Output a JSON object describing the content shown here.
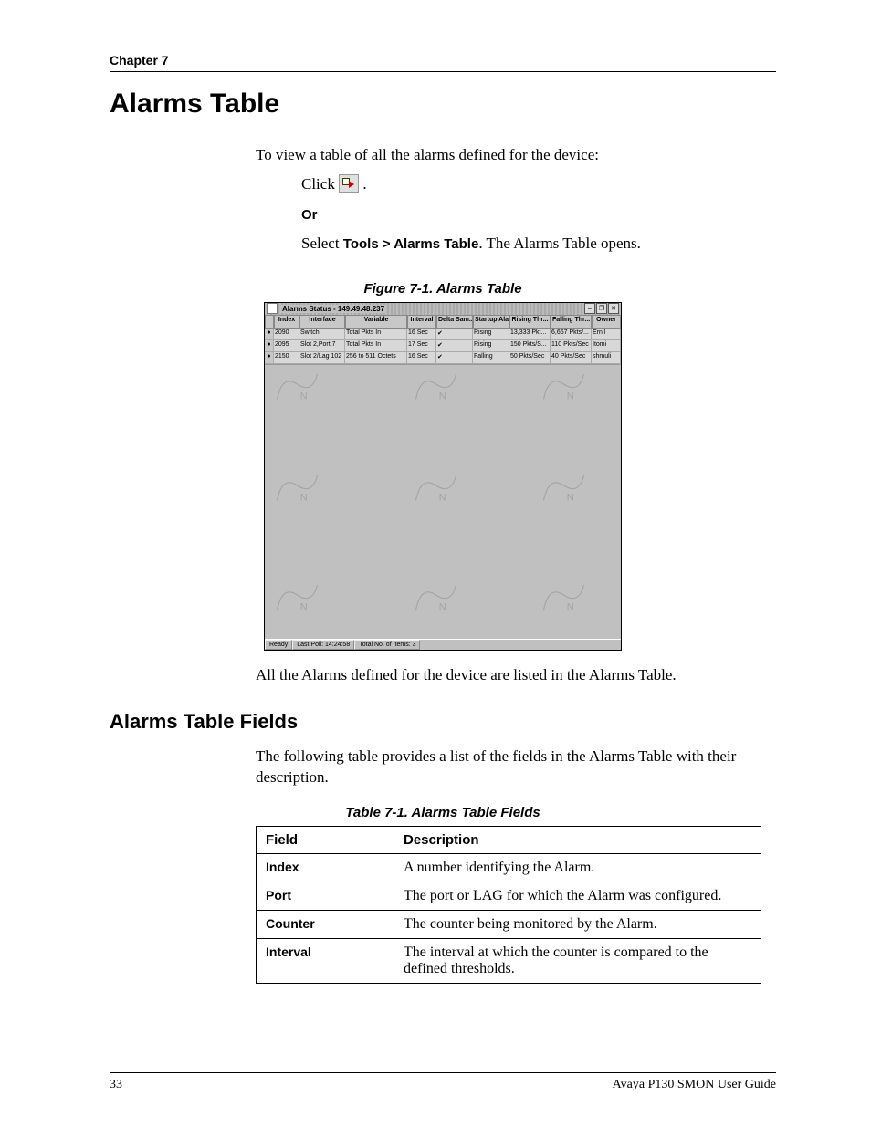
{
  "header": {
    "chapter": "Chapter 7"
  },
  "title": "Alarms Table",
  "intro": "To view a table of all the alarms defined for the device:",
  "steps": {
    "click_label": "Click ",
    "icon_name": "alarms-toolbar-icon",
    "period": ".",
    "or": "Or",
    "select_prefix": "Select ",
    "select_bold": "Tools > Alarms Table",
    "select_suffix": ". The Alarms Table opens."
  },
  "figure": {
    "caption": "Figure 7-1.  Alarms Table",
    "window_title": "Alarms Status - 149.49.48.237",
    "columns": [
      "",
      "Index",
      "Interface",
      "Variable",
      "Interval",
      "Delta Sam...",
      "Startup Ala...",
      "Rising Thr...",
      "Falling Thr...",
      "Owner"
    ],
    "rows": [
      [
        "●",
        "2090",
        "Switch",
        "Total Pkts In",
        "16 Sec",
        "✔",
        "Rising",
        "13,333 Pkt...",
        "6,667 Pkts/...",
        "Ernil"
      ],
      [
        "●",
        "2095",
        "Slot 2,Port 7",
        "Total Pkts In",
        "17 Sec",
        "✔",
        "Rising",
        "150 Pkts/S...",
        "110 Pkts/Sec",
        "Itomi"
      ],
      [
        "●",
        "2150",
        "Slot 2/Lag 102",
        "256 to 511 Octets",
        "16 Sec",
        "✔",
        "Falling",
        "50 Pkts/Sec",
        "40 Pkts/Sec",
        "shmuli"
      ]
    ],
    "status": {
      "ready": "Ready",
      "last_poll": "Last Poll: 14:24:58",
      "total": "Total No. of Items: 3"
    }
  },
  "after_figure": "All the Alarms defined for the device are listed in the Alarms Table.",
  "section2": {
    "title": "Alarms Table Fields",
    "intro": "The following table provides a list of the fields in the Alarms Table with their description."
  },
  "fields_table": {
    "caption": "Table 7-1.  Alarms Table Fields",
    "headers": [
      "Field",
      "Description"
    ],
    "rows": [
      {
        "field": "Index",
        "desc": "A number identifying the Alarm."
      },
      {
        "field": "Port",
        "desc": "The port or LAG for which the Alarm was configured."
      },
      {
        "field": "Counter",
        "desc": "The counter being monitored by the Alarm."
      },
      {
        "field": "Interval",
        "desc": "The interval at which the counter is compared to the defined thresholds."
      }
    ]
  },
  "footer": {
    "page": "33",
    "doc": "Avaya P130 SMON User Guide"
  }
}
